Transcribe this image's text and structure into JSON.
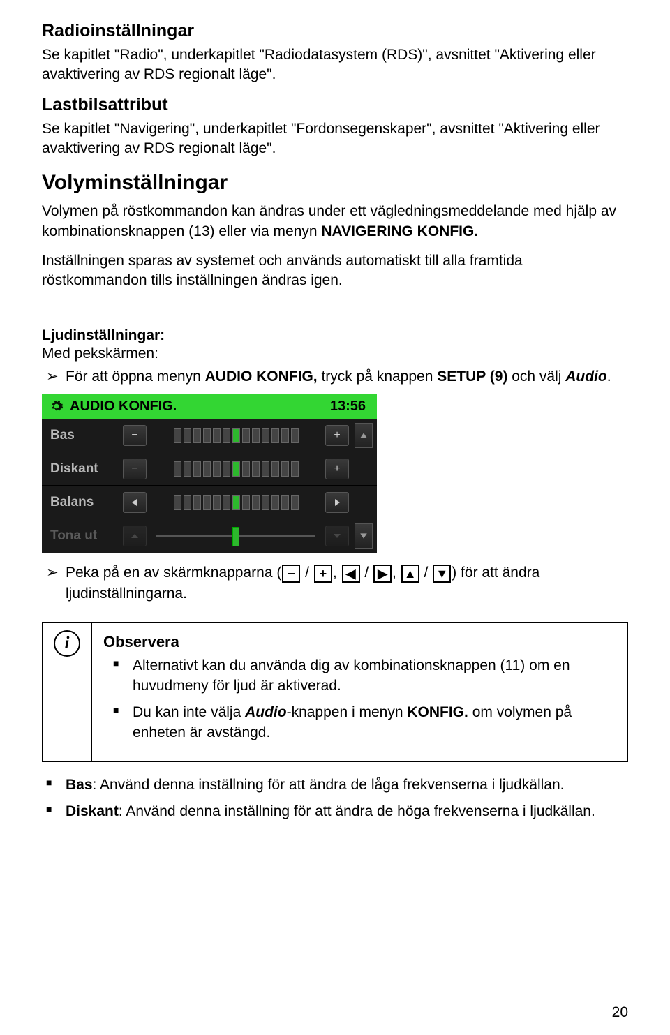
{
  "radio": {
    "heading": "Radioinställningar",
    "body": "Se kapitlet \"Radio\", underkapitlet \"Radiodatasystem (RDS)\", avsnittet \"Aktivering eller avaktivering av RDS regionalt läge\"."
  },
  "truck": {
    "heading": "Lastbilsattribut",
    "body": "Se kapitlet \"Navigering\", underkapitlet \"Fordonsegenskaper\", avsnittet \"Aktivering eller avaktivering av RDS regionalt läge\"."
  },
  "volume": {
    "heading": "Volyminställningar",
    "p1_a": "Volymen på röstkommandon kan ändras under ett vägledningsmeddelande med hjälp av kombinationsknappen (13) eller via menyn ",
    "p1_b": "NAVIGERING KONFIG.",
    "p2": "Inställningen sparas av systemet och används automatiskt till alla framtida röstkommandon tills inställningen ändras igen."
  },
  "sound": {
    "heading_sub": "Ljudinställningar:",
    "subtitle": "Med pekskärmen:",
    "bullet1_a": "För att öppna menyn ",
    "bullet1_b": "AUDIO KONFIG,",
    "bullet1_c": " tryck på knappen ",
    "bullet1_d": "SETUP (9)",
    "bullet1_e": " och välj ",
    "bullet1_f": "Audio",
    "bullet1_g": ".",
    "bullet2_a": "Peka på en av skärmknapparna (",
    "bullet2_b": ") för att ändra ljudinställningarna."
  },
  "audio_panel": {
    "title": "AUDIO KONFIG.",
    "time": "13:56",
    "rows": {
      "bass": "Bas",
      "treble": "Diskant",
      "balance": "Balans",
      "fade": "Tona ut"
    }
  },
  "icons": {
    "minus": "−",
    "plus": "+",
    "left": "◀",
    "right": "▶",
    "up": "▲",
    "down": "▼",
    "slash": " / ",
    "comma": ", "
  },
  "note": {
    "heading": "Observera",
    "b1": "Alternativt kan du använda dig av kombinationsknappen (11) om en huvudmeny för ljud är aktiverad.",
    "b2_a": "Du kan inte välja ",
    "b2_b": "Audio",
    "b2_c": "-knappen i menyn ",
    "b2_d": "KONFIG.",
    "b2_e": " om volymen på enheten är avstängd."
  },
  "defs": {
    "bass_a": "Bas",
    "bass_b": ": Använd denna inställning för att ändra de låga frekvenserna i ljudkällan.",
    "treble_a": "Diskant",
    "treble_b": ": Använd denna inställning för att ändra de höga frekvenserna i ljudkällan."
  },
  "page_num": "20",
  "info_i": "i"
}
